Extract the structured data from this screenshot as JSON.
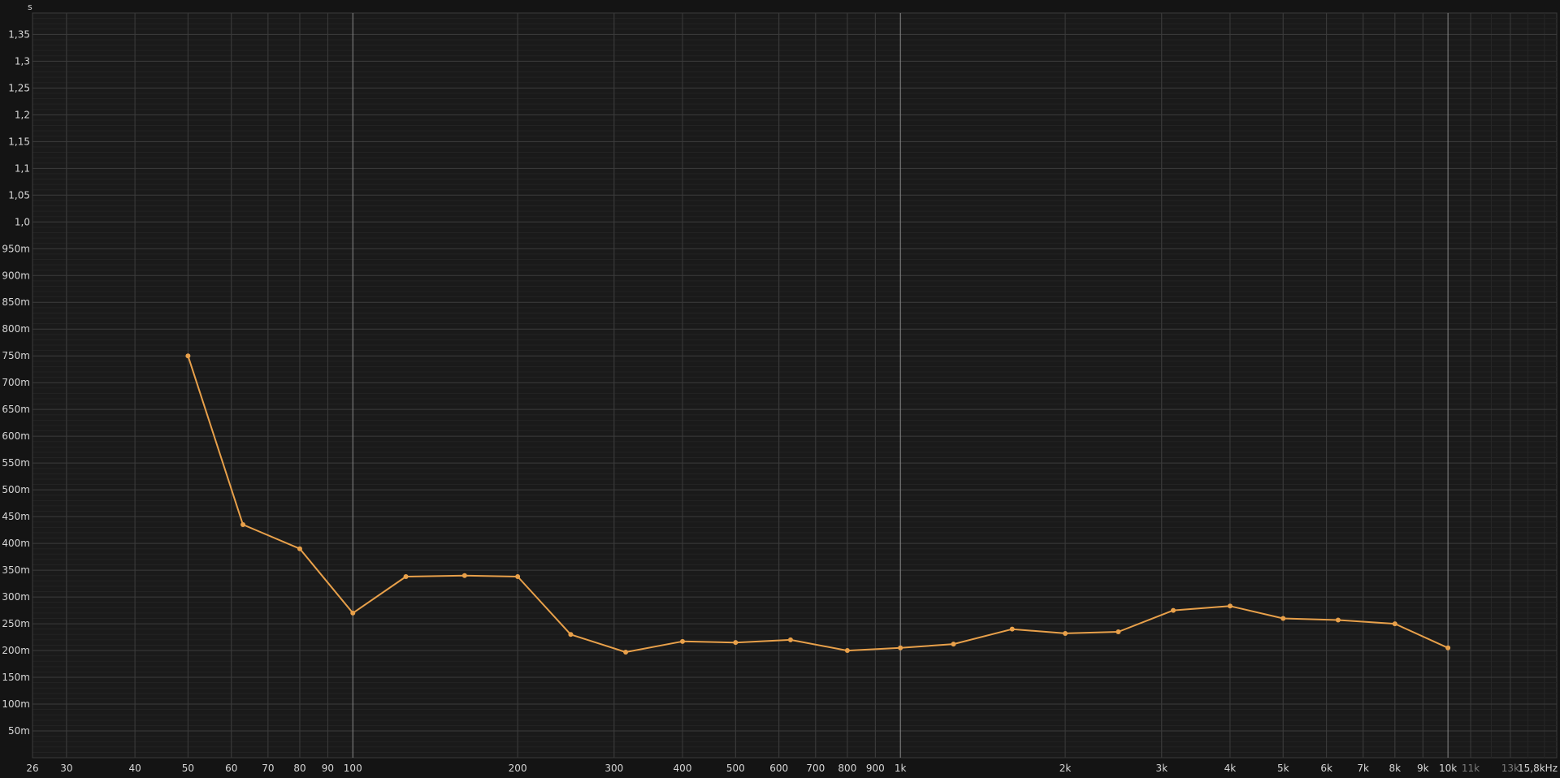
{
  "chart_data": {
    "type": "line",
    "x_scale": "log",
    "y_unit_label": "s",
    "x_unit_label": "15,8kHz",
    "x_ticks": [
      {
        "v": 26,
        "label": "26"
      },
      {
        "v": 30,
        "label": "30"
      },
      {
        "v": 40,
        "label": "40"
      },
      {
        "v": 50,
        "label": "50"
      },
      {
        "v": 60,
        "label": "60"
      },
      {
        "v": 70,
        "label": "70"
      },
      {
        "v": 80,
        "label": "80"
      },
      {
        "v": 90,
        "label": "90"
      },
      {
        "v": 100,
        "label": "100"
      },
      {
        "v": 200,
        "label": "200"
      },
      {
        "v": 300,
        "label": "300"
      },
      {
        "v": 400,
        "label": "400"
      },
      {
        "v": 500,
        "label": "500"
      },
      {
        "v": 600,
        "label": "600"
      },
      {
        "v": 700,
        "label": "700"
      },
      {
        "v": 800,
        "label": "800"
      },
      {
        "v": 900,
        "label": "900"
      },
      {
        "v": 1000,
        "label": "1k"
      },
      {
        "v": 2000,
        "label": "2k"
      },
      {
        "v": 3000,
        "label": "3k"
      },
      {
        "v": 4000,
        "label": "4k"
      },
      {
        "v": 5000,
        "label": "5k"
      },
      {
        "v": 6000,
        "label": "6k"
      },
      {
        "v": 7000,
        "label": "7k"
      },
      {
        "v": 8000,
        "label": "8k"
      },
      {
        "v": 9000,
        "label": "9k"
      },
      {
        "v": 10000,
        "label": "10k"
      },
      {
        "v": 11000,
        "label": "11k",
        "dim": true
      },
      {
        "v": 13000,
        "label": "13k",
        "dim": true
      }
    ],
    "y_ticks": [
      {
        "v": 0.05,
        "label": "50m"
      },
      {
        "v": 0.1,
        "label": "100m"
      },
      {
        "v": 0.15,
        "label": "150m"
      },
      {
        "v": 0.2,
        "label": "200m"
      },
      {
        "v": 0.25,
        "label": "250m"
      },
      {
        "v": 0.3,
        "label": "300m"
      },
      {
        "v": 0.35,
        "label": "350m"
      },
      {
        "v": 0.4,
        "label": "400m"
      },
      {
        "v": 0.45,
        "label": "450m"
      },
      {
        "v": 0.5,
        "label": "500m"
      },
      {
        "v": 0.55,
        "label": "550m"
      },
      {
        "v": 0.6,
        "label": "600m"
      },
      {
        "v": 0.65,
        "label": "650m"
      },
      {
        "v": 0.7,
        "label": "700m"
      },
      {
        "v": 0.75,
        "label": "750m"
      },
      {
        "v": 0.8,
        "label": "800m"
      },
      {
        "v": 0.85,
        "label": "850m"
      },
      {
        "v": 0.9,
        "label": "900m"
      },
      {
        "v": 0.95,
        "label": "950m"
      },
      {
        "v": 1.0,
        "label": "1,0"
      },
      {
        "v": 1.05,
        "label": "1,05"
      },
      {
        "v": 1.1,
        "label": "1,1"
      },
      {
        "v": 1.15,
        "label": "1,15"
      },
      {
        "v": 1.2,
        "label": "1,2"
      },
      {
        "v": 1.25,
        "label": "1,25"
      },
      {
        "v": 1.3,
        "label": "1,3"
      },
      {
        "v": 1.35,
        "label": "1,35"
      }
    ],
    "xlim": [
      26,
      15800
    ],
    "ylim": [
      0,
      1.39
    ],
    "grid": true,
    "series": [
      {
        "color": "#e8a04a",
        "points": [
          {
            "x": 50,
            "y": 0.75
          },
          {
            "x": 63,
            "y": 0.435
          },
          {
            "x": 80,
            "y": 0.39
          },
          {
            "x": 100,
            "y": 0.27
          },
          {
            "x": 125,
            "y": 0.338
          },
          {
            "x": 160,
            "y": 0.34
          },
          {
            "x": 200,
            "y": 0.338
          },
          {
            "x": 250,
            "y": 0.23
          },
          {
            "x": 315,
            "y": 0.197
          },
          {
            "x": 400,
            "y": 0.217
          },
          {
            "x": 500,
            "y": 0.215
          },
          {
            "x": 630,
            "y": 0.22
          },
          {
            "x": 800,
            "y": 0.2
          },
          {
            "x": 1000,
            "y": 0.205
          },
          {
            "x": 1250,
            "y": 0.212
          },
          {
            "x": 1600,
            "y": 0.24
          },
          {
            "x": 2000,
            "y": 0.232
          },
          {
            "x": 2500,
            "y": 0.235
          },
          {
            "x": 3150,
            "y": 0.275
          },
          {
            "x": 4000,
            "y": 0.283
          },
          {
            "x": 5000,
            "y": 0.26
          },
          {
            "x": 6300,
            "y": 0.257
          },
          {
            "x": 8000,
            "y": 0.25
          },
          {
            "x": 10000,
            "y": 0.205
          }
        ]
      }
    ]
  }
}
